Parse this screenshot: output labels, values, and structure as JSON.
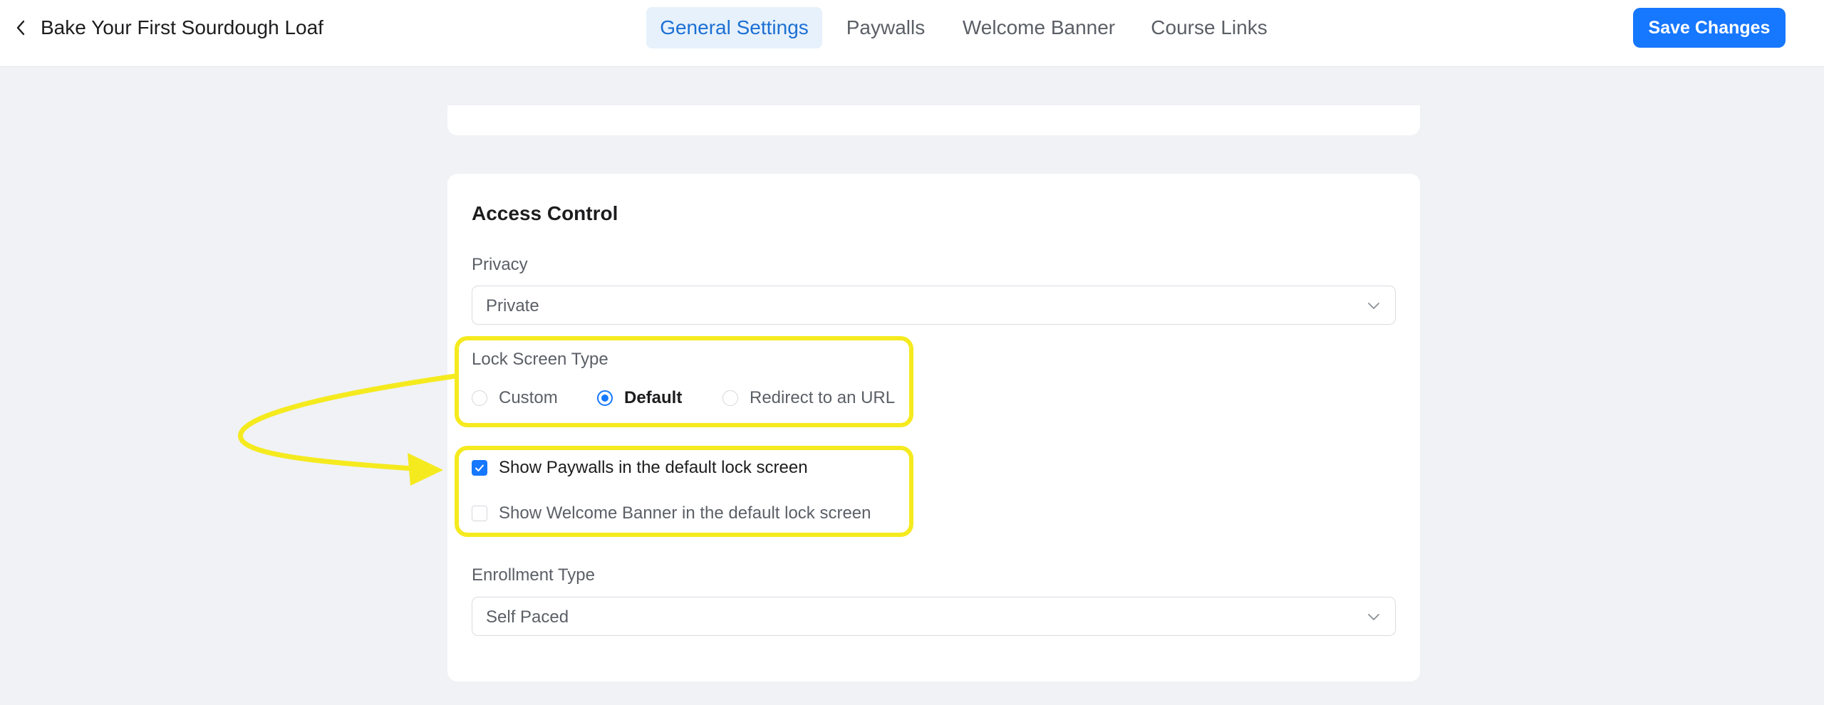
{
  "header": {
    "back_icon": "chevron-left-icon",
    "course_title": "Bake Your First Sourdough Loaf",
    "tabs": [
      {
        "label": "General Settings",
        "active": true
      },
      {
        "label": "Paywalls",
        "active": false
      },
      {
        "label": "Welcome Banner",
        "active": false
      },
      {
        "label": "Course Links",
        "active": false
      }
    ],
    "save_label": "Save Changes"
  },
  "access_control": {
    "title": "Access Control",
    "privacy": {
      "label": "Privacy",
      "value": "Private",
      "icon": "chevron-down-icon"
    },
    "lock_screen": {
      "label": "Lock Screen Type",
      "options": [
        {
          "label": "Custom",
          "selected": false
        },
        {
          "label": "Default",
          "selected": true
        },
        {
          "label": "Redirect to an URL",
          "selected": false
        }
      ]
    },
    "checkboxes": [
      {
        "label": "Show Paywalls in the default lock screen",
        "checked": true
      },
      {
        "label": "Show Welcome Banner in the default lock screen",
        "checked": false
      }
    ],
    "enrollment": {
      "label": "Enrollment Type",
      "value": "Self Paced",
      "icon": "chevron-down-icon"
    }
  },
  "colors": {
    "accent": "#1677ff",
    "highlight": "#f5ea1e",
    "background": "#f0f2f5",
    "active_tab_bg": "#e6f1fc"
  }
}
